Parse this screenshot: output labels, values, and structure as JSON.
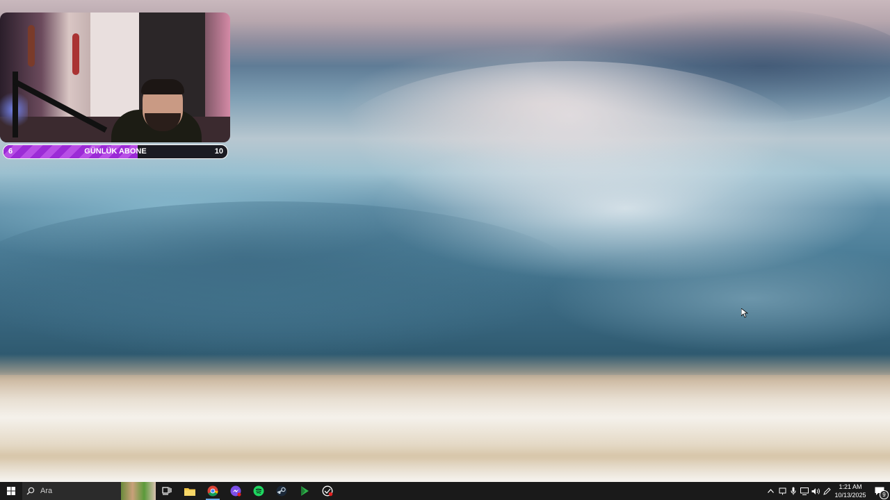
{
  "overlay": {
    "goal_current": "6",
    "goal_label": "GÜNLÜK ABONE",
    "goal_target": "10",
    "goal_progress_fraction": 0.6,
    "accent_color": "#9b2bd6"
  },
  "taskbar": {
    "search_placeholder": "Ara",
    "pinned_apps": [
      "task-view",
      "file-explorer",
      "chrome",
      "messenger",
      "spotify",
      "steam",
      "green-play-app",
      "recording-app"
    ],
    "active_app": "chrome",
    "tray_icons": [
      "chevron-up-icon",
      "network-monitor-icon",
      "wifi-icon",
      "microphone-icon",
      "display-icon",
      "volume-icon",
      "pen-icon"
    ],
    "time": "1:21 AM",
    "date": "10/13/2025",
    "notification_count": "9"
  }
}
